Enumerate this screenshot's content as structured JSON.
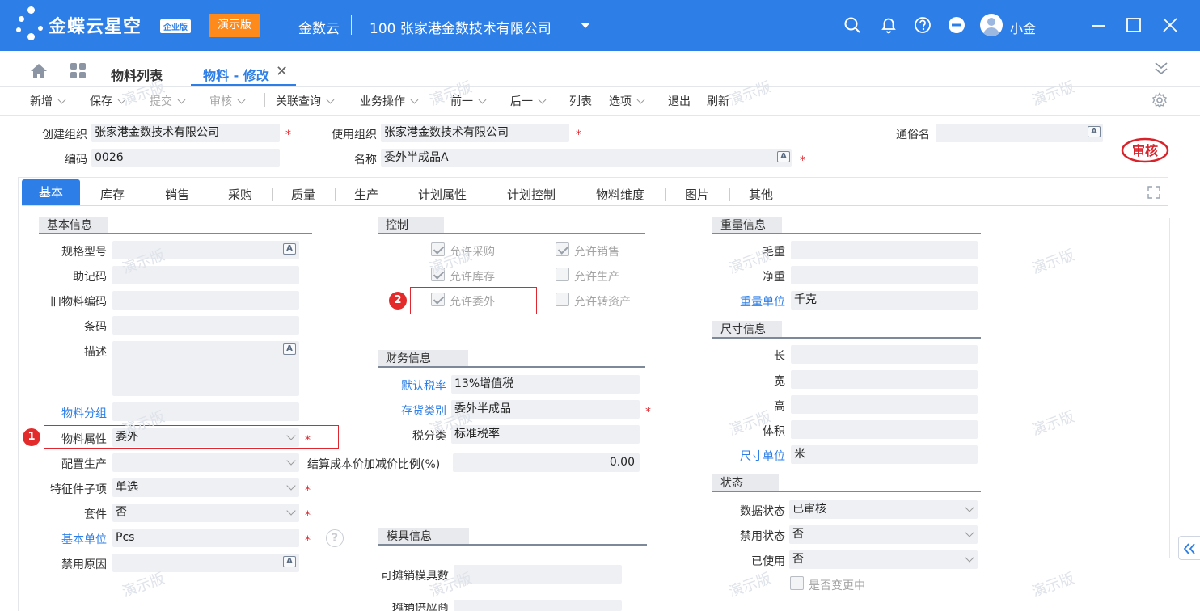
{
  "topbar": {
    "brand": "金蝶云星空",
    "brand_badge": "企业版",
    "demo_button": "演示版",
    "cloud": "金数云",
    "company": "100  张家港金数技术有限公司",
    "user": "小金",
    "brand_color": "#2d7fe7",
    "demo_color": "#ff8a1c"
  },
  "tabs": {
    "list": "物料列表",
    "edit": "物料 - 修改",
    "close": "✕"
  },
  "toolbar": {
    "new": "新增",
    "save": "保存",
    "submit": "提交",
    "audit": "审核",
    "related_query": "关联查询",
    "business_ops": "业务操作",
    "prev": "前一",
    "next": "后一",
    "list": "列表",
    "options": "选项",
    "exit": "退出",
    "refresh": "刷新"
  },
  "header": {
    "create_org_label": "创建组织",
    "create_org": "张家港金数技术有限公司",
    "use_org_label": "使用组织",
    "use_org": "张家港金数技术有限公司",
    "common_name_label": "通俗名",
    "common_name": "",
    "code_label": "编码",
    "code": "0026",
    "name_label": "名称",
    "name": "委外半成品A",
    "stamp": "审核",
    "required": "*"
  },
  "body_tabs": [
    "基本",
    "库存",
    "销售",
    "采购",
    "质量",
    "生产",
    "计划属性",
    "计划控制",
    "物料维度",
    "图片",
    "其他"
  ],
  "basic": {
    "title": "基本信息",
    "spec_label": "规格型号",
    "spec": "",
    "mnemonic_label": "助记码",
    "mnemonic": "",
    "old_code_label": "旧物料编码",
    "old_code": "",
    "barcode_label": "条码",
    "barcode": "",
    "desc_label": "描述",
    "desc": "",
    "group_label": "物料分组",
    "group": "",
    "attr_label": "物料属性",
    "attr": "委外",
    "config_label": "配置生产",
    "config": "",
    "feature_label": "特征件子项",
    "feature": "单选",
    "kit_label": "套件",
    "kit": "否",
    "unit_label": "基本单位",
    "unit": "Pcs",
    "disable_reason_label": "禁用原因",
    "disable_reason": "",
    "settle_label": "结算成本价加减价比例(%)",
    "settle": "0.00"
  },
  "control": {
    "title": "控制",
    "allow_purchase": "允许采购",
    "allow_sale": "允许销售",
    "allow_stock": "允许库存",
    "allow_produce": "允许生产",
    "allow_outsource": "允许委外",
    "allow_asset": "允许转资产"
  },
  "finance": {
    "title": "财务信息",
    "tax_rate_label": "默认税率",
    "tax_rate": "13%增值税",
    "stock_cat_label": "存货类别",
    "stock_cat": "委外半成品",
    "tax_class_label": "税分类",
    "tax_class": "标准税率"
  },
  "mold": {
    "title": "模具信息",
    "amort_label": "可摊销模具数",
    "amort": "",
    "partial_label": "摊销供应商"
  },
  "weight": {
    "title": "重量信息",
    "gross_label": "毛重",
    "gross": "",
    "net_label": "净重",
    "net": "",
    "unit_label": "重量单位",
    "unit": "千克"
  },
  "size": {
    "title": "尺寸信息",
    "length_label": "长",
    "length": "",
    "width_label": "宽",
    "width": "",
    "height_label": "高",
    "height": "",
    "volume_label": "体积",
    "volume": "",
    "unit_label": "尺寸单位",
    "unit": "米"
  },
  "status": {
    "title": "状态",
    "data_label": "数据状态",
    "data": "已审核",
    "forbid_label": "禁用状态",
    "forbid": "否",
    "used_label": "已使用",
    "used": "否",
    "changing_label": "是否变更中"
  },
  "markers": {
    "one": "1",
    "two": "2",
    "help": "?"
  },
  "watermark": "演示版"
}
